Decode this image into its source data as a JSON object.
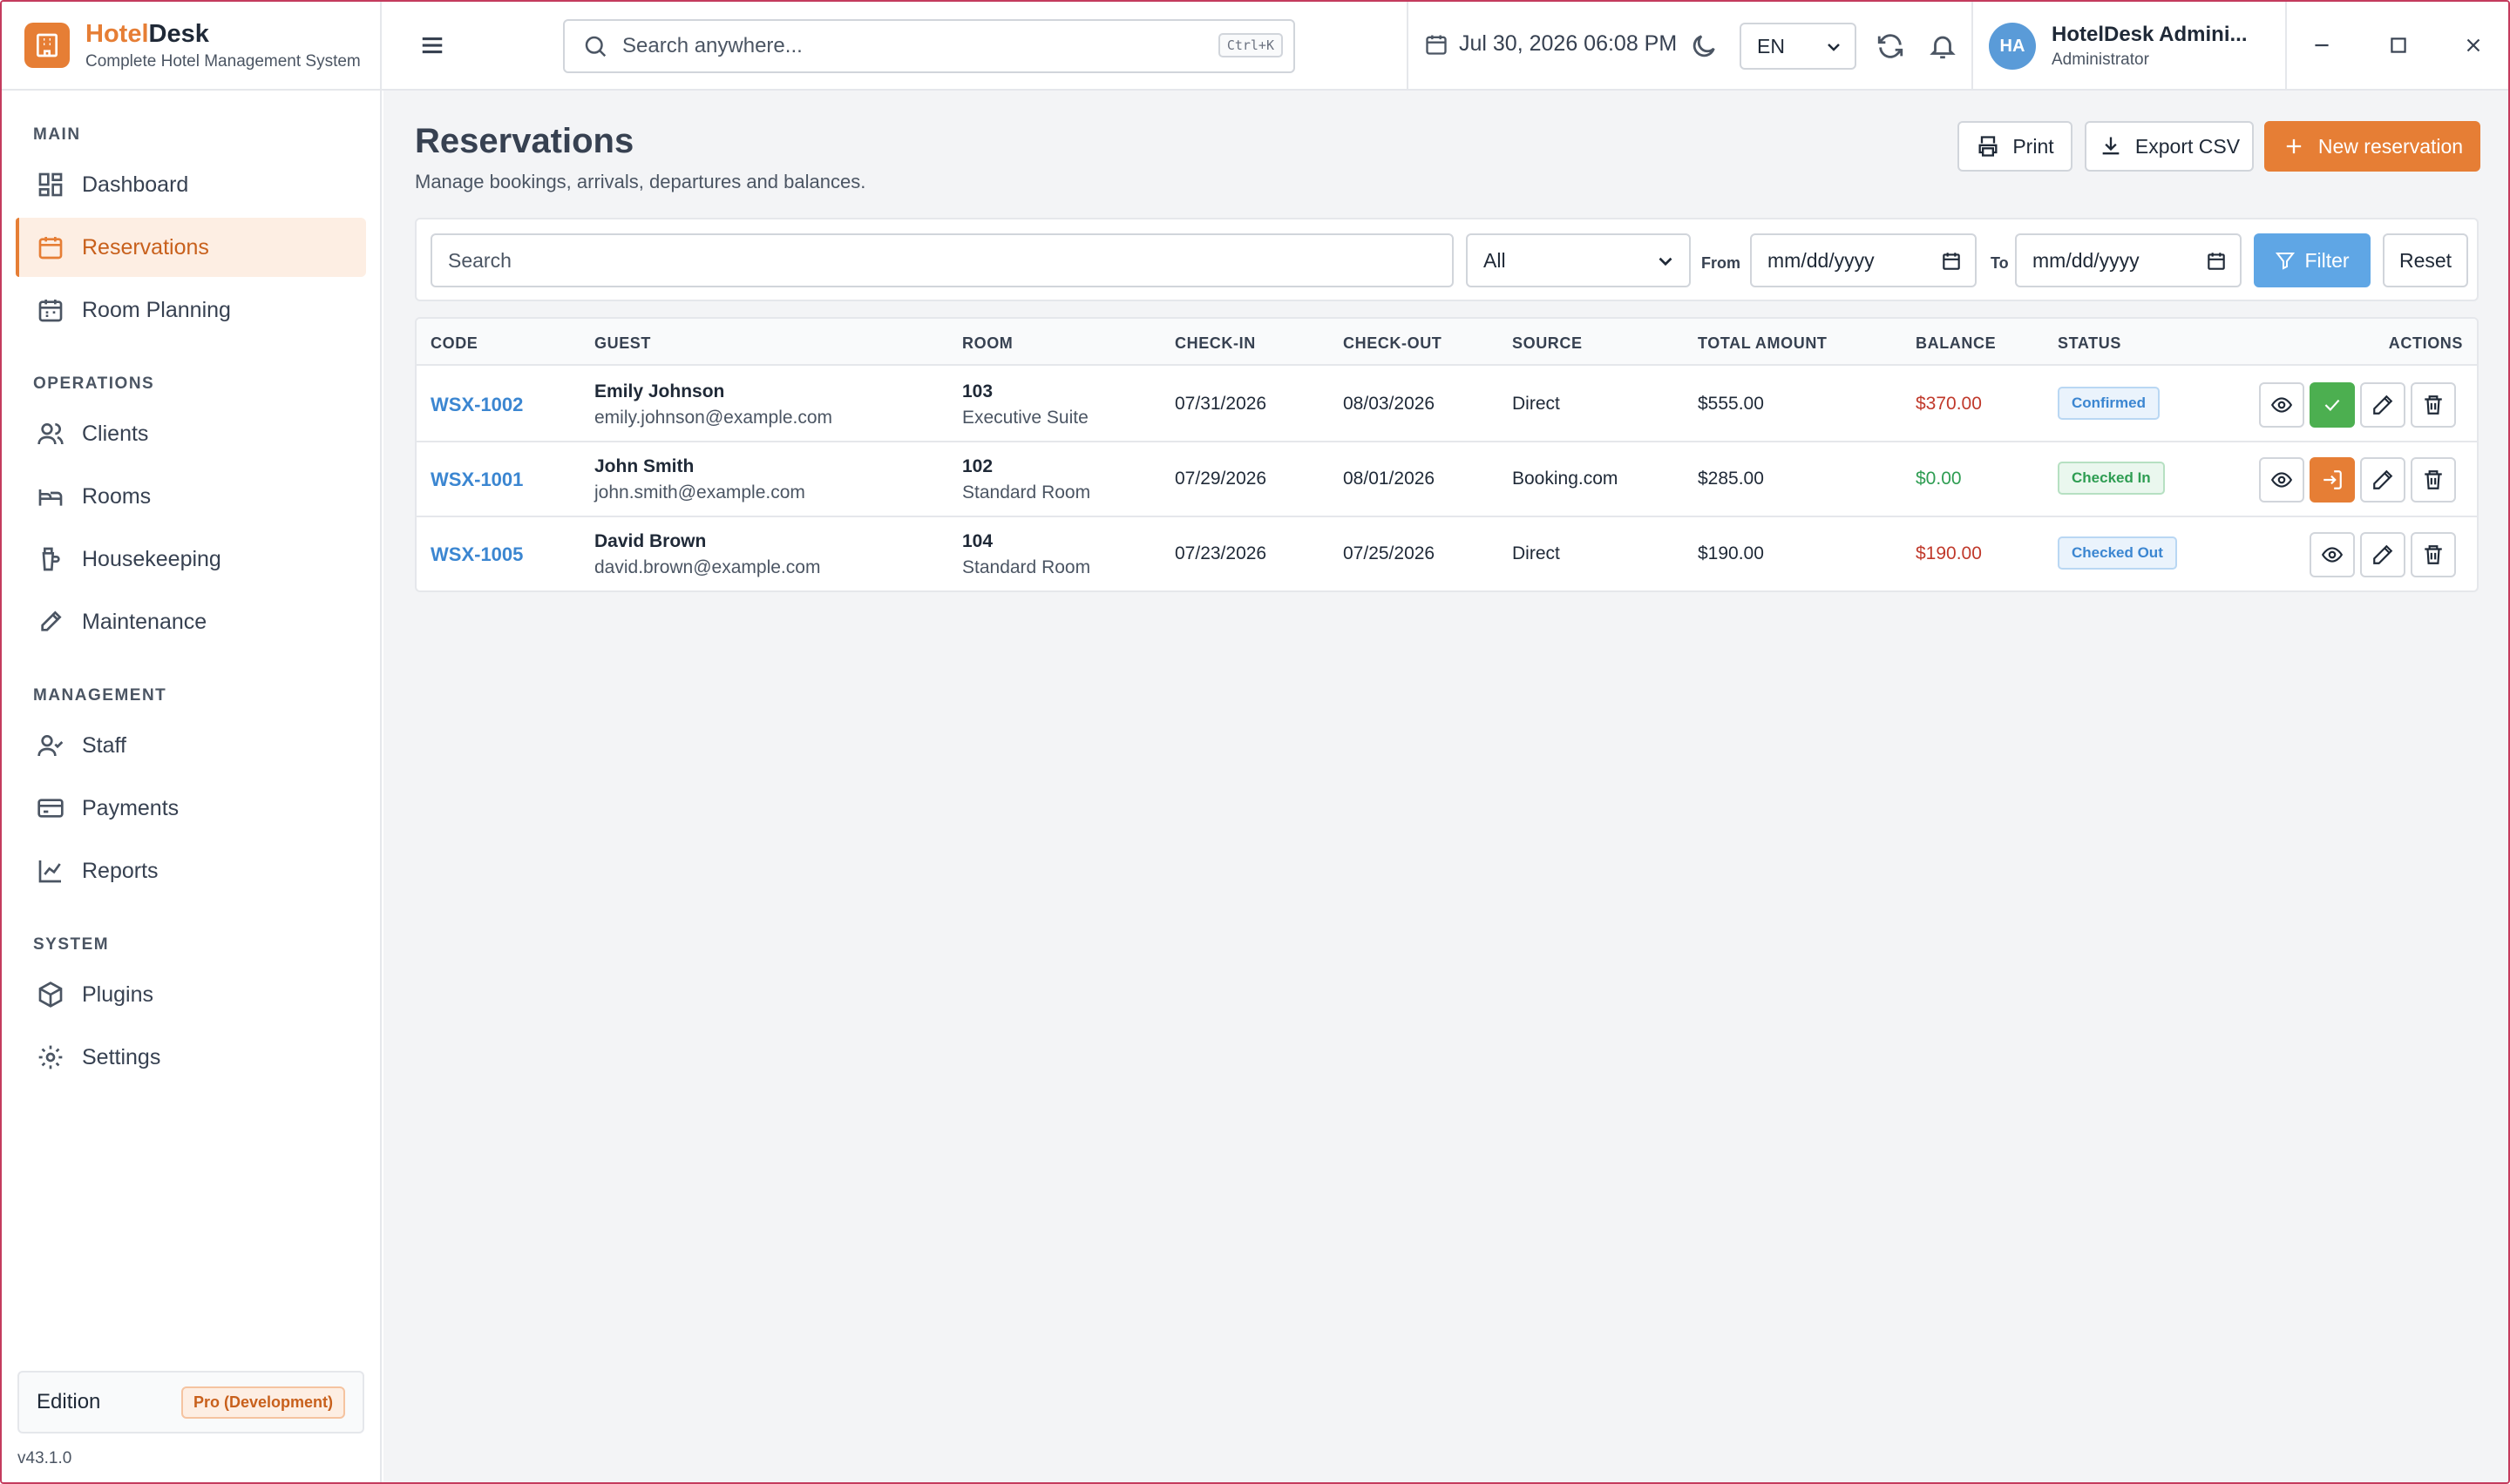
{
  "app": {
    "name_part1": "Hotel",
    "name_part2": "Desk",
    "subtitle": "Complete Hotel Management System",
    "accent_color": "#e67e35"
  },
  "sidebar": {
    "sections": [
      {
        "title": "MAIN",
        "items": [
          {
            "label": "Dashboard",
            "icon": "dashboard-icon"
          },
          {
            "label": "Reservations",
            "icon": "calendar-icon",
            "active": true
          },
          {
            "label": "Room Planning",
            "icon": "calendar-grid-icon"
          }
        ]
      },
      {
        "title": "OPERATIONS",
        "items": [
          {
            "label": "Clients",
            "icon": "users-icon"
          },
          {
            "label": "Rooms",
            "icon": "bed-icon"
          },
          {
            "label": "Housekeeping",
            "icon": "bucket-icon"
          },
          {
            "label": "Maintenance",
            "icon": "wrench-icon"
          }
        ]
      },
      {
        "title": "MANAGEMENT",
        "items": [
          {
            "label": "Staff",
            "icon": "user-check-icon"
          },
          {
            "label": "Payments",
            "icon": "credit-card-icon"
          },
          {
            "label": "Reports",
            "icon": "line-chart-icon"
          }
        ]
      },
      {
        "title": "SYSTEM",
        "items": [
          {
            "label": "Plugins",
            "icon": "package-icon"
          },
          {
            "label": "Settings",
            "icon": "gear-icon"
          }
        ]
      }
    ],
    "edition_label": "Edition",
    "edition_badge": "Pro (Development)",
    "version": "v43.1.0"
  },
  "topbar": {
    "search_placeholder": "Search anywhere...",
    "search_shortcut": "Ctrl+K",
    "datetime": "Jul 30, 2026  06:08 PM",
    "language": "EN",
    "user_initials": "HA",
    "user_name": "HotelDesk Admini...",
    "user_role": "Administrator"
  },
  "page": {
    "title": "Reservations",
    "subtitle": "Manage bookings, arrivals, departures and balances.",
    "print_label": "Print",
    "export_label": "Export CSV",
    "new_label": "New reservation"
  },
  "filters": {
    "search_placeholder": "Search",
    "status_value": "All",
    "from_label": "From",
    "from_placeholder": "mm/dd/yyyy",
    "to_label": "To",
    "to_placeholder": "mm/dd/yyyy",
    "filter_label": "Filter",
    "reset_label": "Reset"
  },
  "table": {
    "headers": {
      "code": "CODE",
      "guest": "GUEST",
      "room": "ROOM",
      "checkin": "CHECK-IN",
      "checkout": "CHECK-OUT",
      "source": "SOURCE",
      "total": "TOTAL AMOUNT",
      "balance": "BALANCE",
      "status": "STATUS",
      "actions": "ACTIONS"
    },
    "rows": [
      {
        "code": "WSX-1002",
        "guest_name": "Emily Johnson",
        "guest_email": "emily.johnson@example.com",
        "room_no": "103",
        "room_type": "Executive Suite",
        "checkin": "07/31/2026",
        "checkout": "08/03/2026",
        "source": "Direct",
        "total": "$555.00",
        "balance": "$370.00",
        "status": "Confirmed"
      },
      {
        "code": "WSX-1001",
        "guest_name": "John Smith",
        "guest_email": "john.smith@example.com",
        "room_no": "102",
        "room_type": "Standard Room",
        "checkin": "07/29/2026",
        "checkout": "08/01/2026",
        "source": "Booking.com",
        "total": "$285.00",
        "balance": "$0.00",
        "status": "Checked In"
      },
      {
        "code": "WSX-1005",
        "guest_name": "David Brown",
        "guest_email": "david.brown@example.com",
        "room_no": "104",
        "room_type": "Standard Room",
        "checkin": "07/23/2026",
        "checkout": "07/25/2026",
        "source": "Direct",
        "total": "$190.00",
        "balance": "$190.00",
        "status": "Checked Out"
      }
    ]
  }
}
